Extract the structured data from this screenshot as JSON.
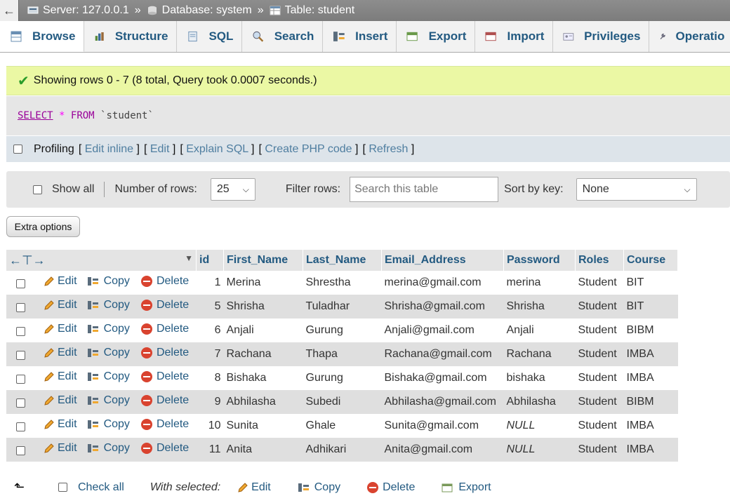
{
  "breadcrumb": {
    "back": "←",
    "server": "Server: 127.0.0.1",
    "sep": "»",
    "database": "Database: system",
    "table": "Table: student"
  },
  "tabs": [
    {
      "label": "Browse",
      "icon": "browse-icon"
    },
    {
      "label": "Structure",
      "icon": "structure-icon"
    },
    {
      "label": "SQL",
      "icon": "sql-icon"
    },
    {
      "label": "Search",
      "icon": "search-icon"
    },
    {
      "label": "Insert",
      "icon": "insert-icon"
    },
    {
      "label": "Export",
      "icon": "export-icon"
    },
    {
      "label": "Import",
      "icon": "import-icon"
    },
    {
      "label": "Privileges",
      "icon": "privileges-icon"
    },
    {
      "label": "Operatio",
      "icon": "operations-icon"
    }
  ],
  "message": "Showing rows 0 - 7 (8 total, Query took 0.0007 seconds.)",
  "sql": {
    "select": "SELECT",
    "star": "*",
    "from": "FROM",
    "table": "`student`"
  },
  "profiling": {
    "label": "Profiling",
    "links": [
      "Edit inline",
      "Edit",
      "Explain SQL",
      "Create PHP code",
      "Refresh"
    ]
  },
  "nav": {
    "show_all": "Show all",
    "rows_label": "Number of rows:",
    "rows_value": "25",
    "filter_label": "Filter rows:",
    "filter_placeholder": "Search this table",
    "sort_label": "Sort by key:",
    "sort_value": "None"
  },
  "extra_options": "Extra options",
  "table": {
    "columns": [
      "id",
      "First_Name",
      "Last_Name",
      "Email_Address",
      "Password",
      "Roles",
      "Course"
    ],
    "actions": {
      "edit": "Edit",
      "copy": "Copy",
      "delete": "Delete"
    },
    "rows": [
      {
        "id": "1",
        "first": "Merina",
        "last": "Shrestha",
        "email": "merina@gmail.com",
        "password": "merina",
        "role": "Student",
        "course": "BIT"
      },
      {
        "id": "5",
        "first": "Shrisha",
        "last": "Tuladhar",
        "email": "Shrisha@gmail.com",
        "password": "Shrisha",
        "role": "Student",
        "course": "BIT"
      },
      {
        "id": "6",
        "first": "Anjali",
        "last": "Gurung",
        "email": "Anjali@gmail.com",
        "password": "Anjali",
        "role": "Student",
        "course": "BIBM"
      },
      {
        "id": "7",
        "first": "Rachana",
        "last": "Thapa",
        "email": "Rachana@gmail.com",
        "password": "Rachana",
        "role": "Student",
        "course": "IMBA"
      },
      {
        "id": "8",
        "first": "Bishaka",
        "last": "Gurung",
        "email": "Bishaka@gmail.com",
        "password": "bishaka",
        "role": "Student",
        "course": "IMBA"
      },
      {
        "id": "9",
        "first": "Abhilasha",
        "last": "Subedi",
        "email": "Abhilasha@gmail.com",
        "password": "Abhilasha",
        "role": "Student",
        "course": "BIBM"
      },
      {
        "id": "10",
        "first": "Sunita",
        "last": "Ghale",
        "email": "Sunita@gmail.com",
        "password": "NULL",
        "role": "Student",
        "course": "IMBA"
      },
      {
        "id": "11",
        "first": "Anita",
        "last": "Adhikari",
        "email": "Anita@gmail.com",
        "password": "NULL",
        "role": "Student",
        "course": "IMBA"
      }
    ]
  },
  "bottom": {
    "check_all": "Check all",
    "with_selected": "With selected:",
    "edit": "Edit",
    "copy": "Copy",
    "delete": "Delete",
    "export": "Export"
  }
}
